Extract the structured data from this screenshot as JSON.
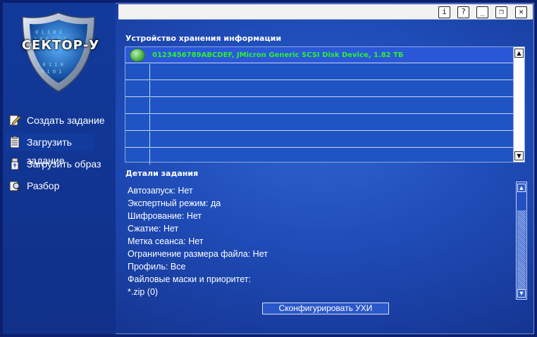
{
  "window": {
    "buttons": {
      "info": "i",
      "help": "?",
      "minimize": "_",
      "restore": "❐",
      "close": "✕"
    }
  },
  "brand": {
    "logo_text": "СЕКТОР-У"
  },
  "sidebar": {
    "items": [
      {
        "label": "Создать задание",
        "icon": "edit-icon",
        "active": false
      },
      {
        "label": "Загрузить задание",
        "icon": "task-list-icon",
        "active": true
      },
      {
        "label": "Загрузить образ",
        "icon": "usb-drive-icon",
        "active": false
      },
      {
        "label": "Разбор",
        "icon": "magnifier-icon",
        "active": false
      }
    ]
  },
  "storage": {
    "title": "Устройство хранения информации",
    "devices": [
      {
        "name": "0123456789ABCDEF, JMicron Generic SCSI Disk Device, 1.82 ТБ",
        "selected": true
      }
    ],
    "empty_rows": 6
  },
  "details": {
    "title": "Детали задания",
    "lines": [
      "Автозапуск: Нет",
      "Экспертный режим: да",
      "Шифрование: Нет",
      "Сжатие: Нет",
      "Метка сеанса: Нет",
      "Ограничение размера файла: Нет",
      "Профиль: Все",
      "Файловые маски и приоритет:",
      "*.zip (0)"
    ]
  },
  "actions": {
    "configure_label": "Сконфигурировать УХИ"
  },
  "colors": {
    "device_text": "#30f030",
    "background": "#1f4cb7"
  }
}
